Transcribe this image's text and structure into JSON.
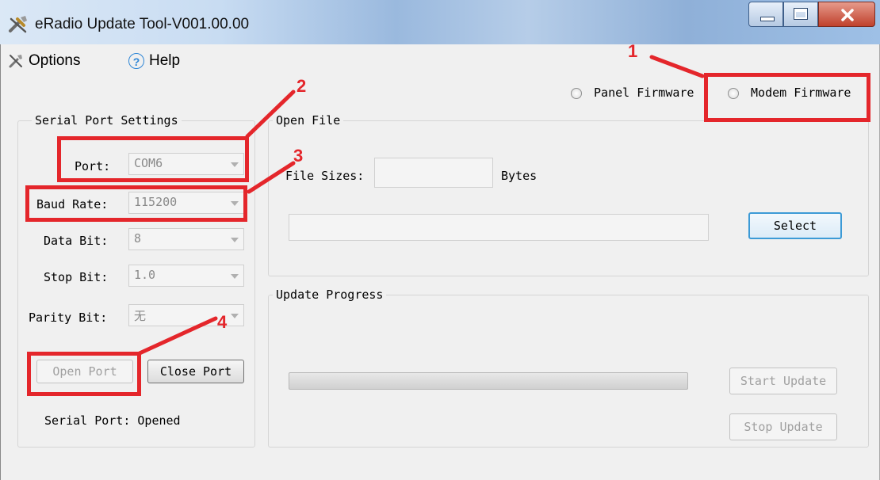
{
  "window": {
    "title": "eRadio Update Tool-V001.00.00"
  },
  "menu": {
    "options_label": "Options",
    "help_label": "Help",
    "help_icon_glyph": "?"
  },
  "firmware": {
    "panel_label": "Panel Firmware",
    "modem_label": "Modem Firmware"
  },
  "serial": {
    "group_title": "Serial Port Settings",
    "port_label": "Port:",
    "port_value": "COM6",
    "baud_label": "Baud Rate:",
    "baud_value": "115200",
    "data_label": "Data Bit:",
    "data_value": "8",
    "stop_label": "Stop Bit:",
    "stop_value": "1.0",
    "parity_label": "Parity Bit:",
    "parity_value": "无",
    "open_port_label": "Open Port",
    "close_port_label": "Close Port",
    "status_text": "Serial Port: Opened"
  },
  "open_file": {
    "group_title": "Open File",
    "file_sizes_label": "File Sizes:",
    "file_sizes_value": "",
    "bytes_label": "Bytes",
    "path_value": "",
    "select_label": "Select"
  },
  "update": {
    "group_title": "Update Progress",
    "progress": 0,
    "start_label": "Start Update",
    "stop_label": "Stop Update"
  },
  "annotations": {
    "color": "#e4262b",
    "markers": [
      "1",
      "2",
      "3",
      "4"
    ]
  }
}
